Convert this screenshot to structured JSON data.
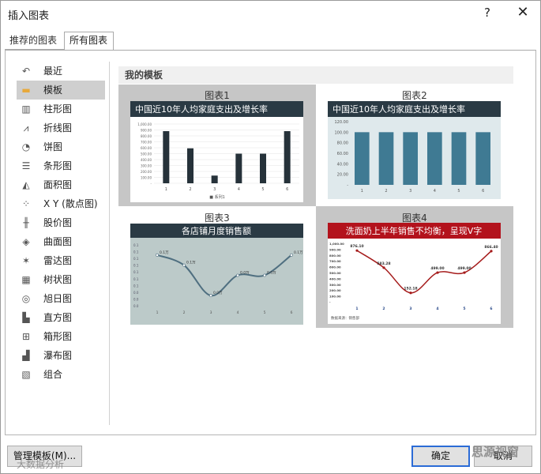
{
  "dialog": {
    "title": "插入图表",
    "help": "?",
    "close": "✕"
  },
  "tabs": [
    {
      "label": "推荐的图表"
    },
    {
      "label": "所有图表"
    }
  ],
  "sidebar": {
    "items": [
      {
        "label": "最近",
        "icon": "recent-icon",
        "glyph": "↶"
      },
      {
        "label": "模板",
        "icon": "folder-icon",
        "glyph": "▬"
      },
      {
        "label": "柱形图",
        "icon": "column-chart-icon",
        "glyph": "▥"
      },
      {
        "label": "折线图",
        "icon": "line-chart-icon",
        "glyph": "⩘"
      },
      {
        "label": "饼图",
        "icon": "pie-chart-icon",
        "glyph": "◔"
      },
      {
        "label": "条形图",
        "icon": "bar-chart-icon",
        "glyph": "☰"
      },
      {
        "label": "面积图",
        "icon": "area-chart-icon",
        "glyph": "◭"
      },
      {
        "label": "X Y (散点图)",
        "icon": "scatter-chart-icon",
        "glyph": "⁘"
      },
      {
        "label": "股价图",
        "icon": "stock-chart-icon",
        "glyph": "╫"
      },
      {
        "label": "曲面图",
        "icon": "surface-chart-icon",
        "glyph": "◈"
      },
      {
        "label": "雷达图",
        "icon": "radar-chart-icon",
        "glyph": "✶"
      },
      {
        "label": "树状图",
        "icon": "treemap-chart-icon",
        "glyph": "▦"
      },
      {
        "label": "旭日图",
        "icon": "sunburst-chart-icon",
        "glyph": "◎"
      },
      {
        "label": "直方图",
        "icon": "histogram-chart-icon",
        "glyph": "▙"
      },
      {
        "label": "箱形图",
        "icon": "box-whisker-chart-icon",
        "glyph": "⊞"
      },
      {
        "label": "瀑布图",
        "icon": "waterfall-chart-icon",
        "glyph": "▟"
      },
      {
        "label": "组合",
        "icon": "combo-chart-icon",
        "glyph": "▧"
      }
    ]
  },
  "section": {
    "title": "我的模板"
  },
  "templates": [
    {
      "label": "图表1",
      "chart_title": "中国近10年人均家庭支出及增长率",
      "legend": "■ 系列1",
      "yticks": [
        "1,000.00",
        "900.00",
        "800.00",
        "700.00",
        "600.00",
        "500.00",
        "400.00",
        "300.00",
        "200.00",
        "100.00",
        "-"
      ],
      "categories": [
        "1",
        "2",
        "3",
        "4",
        "5",
        "6"
      ]
    },
    {
      "label": "图表2",
      "chart_title": "中国近10年人均家庭支出及增长率",
      "yticks": [
        "120.00",
        "100.00",
        "80.00",
        "60.00",
        "40.00",
        "20.00",
        "-"
      ],
      "categories": [
        "1",
        "2",
        "3",
        "4",
        "5",
        "6"
      ]
    },
    {
      "label": "图表3",
      "chart_title": "各店铺月度销售额",
      "yticks": [
        "0.1",
        "0.1",
        "0.1",
        "0.1",
        "0.1",
        "0.1",
        "0.1",
        "0.0",
        "0.0",
        "0.0"
      ],
      "categories": [
        "1",
        "2",
        "3",
        "4",
        "5",
        "6"
      ],
      "point_labels": [
        "0.1万",
        "0.1万",
        "0.0万",
        "0.0万",
        "0.0万",
        "0.1万"
      ]
    },
    {
      "label": "图表4",
      "chart_title": "洗面奶上半年销售不均衡，呈现V字",
      "yticks": [
        "1,000.00",
        "900.00",
        "800.00",
        "700.00",
        "600.00",
        "500.00",
        "400.00",
        "300.00",
        "200.00",
        "100.00",
        "-"
      ],
      "categories": [
        "1",
        "2",
        "3",
        "4",
        "5",
        "6"
      ],
      "point_labels": [
        "876.10",
        "583.28",
        "152.18",
        "499.00",
        "499.00",
        "866.40"
      ],
      "footer": "数据来源：销售部"
    }
  ],
  "chart_data": [
    {
      "type": "bar",
      "title": "中国近10年人均家庭支出及增长率",
      "categories": [
        "1",
        "2",
        "3",
        "4",
        "5",
        "6"
      ],
      "series": [
        {
          "name": "系列1",
          "values": [
            880,
            590,
            130,
            500,
            500,
            880
          ]
        }
      ],
      "ylim": [
        0,
        1000
      ]
    },
    {
      "type": "bar",
      "title": "中国近10年人均家庭支出及增长率",
      "categories": [
        "1",
        "2",
        "3",
        "4",
        "5",
        "6"
      ],
      "values": [
        100,
        100,
        100,
        100,
        100,
        100
      ],
      "ylim": [
        0,
        120
      ]
    },
    {
      "type": "line",
      "title": "各店铺月度销售额",
      "categories": [
        "1",
        "2",
        "3",
        "4",
        "5",
        "6"
      ],
      "values": [
        0.1,
        0.08,
        0.02,
        0.06,
        0.06,
        0.1
      ],
      "ylim": [
        0,
        0.12
      ]
    },
    {
      "type": "line",
      "title": "洗面奶上半年销售不均衡，呈现V字",
      "categories": [
        "1",
        "2",
        "3",
        "4",
        "5",
        "6"
      ],
      "values": [
        876.1,
        583.28,
        152.18,
        499.0,
        499.0,
        866.4
      ],
      "ylim": [
        0,
        1000
      ]
    }
  ],
  "buttons": {
    "manage": "管理模板(M)...",
    "ok": "确定",
    "cancel": "取消"
  },
  "watermarks": {
    "left": "大数据分析",
    "right": "思源视窗"
  },
  "colors": {
    "dark_title": "#2a3a44",
    "bar_dark": "#26323a",
    "bar_teal": "#3f7a93",
    "red_title": "#b3121c",
    "line_red": "#a51b1b",
    "sage_bg": "#bccac9"
  }
}
